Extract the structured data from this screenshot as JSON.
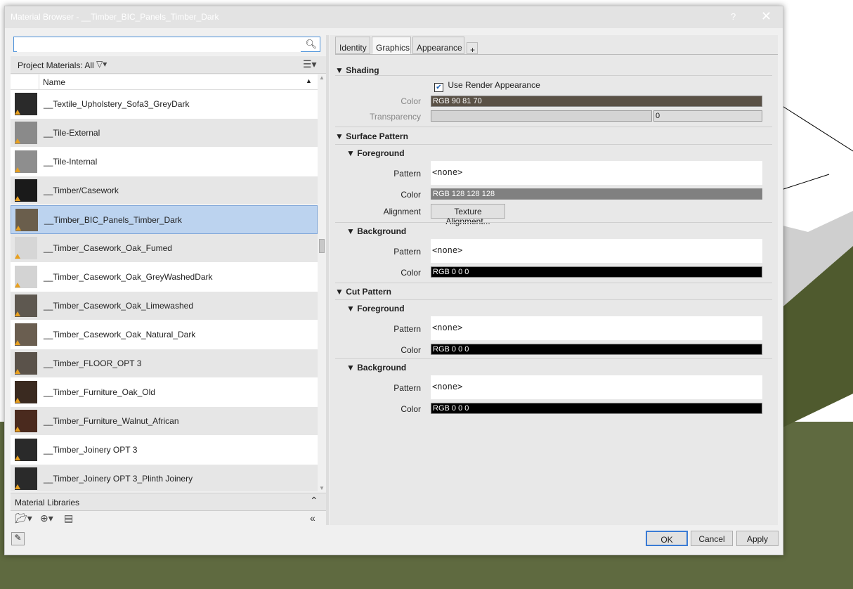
{
  "dialog": {
    "title": "Material Browser - __Timber_BIC_Panels_Timber_Dark",
    "help": "?",
    "close": "✕"
  },
  "search": {
    "value": "",
    "placeholder": ""
  },
  "project_bar": {
    "label": "Project Materials: All"
  },
  "list": {
    "header": {
      "name": "Name"
    },
    "items": [
      {
        "label": "__Textile_Upholstery_Sofa3_GreyDark",
        "thumb_color": "#2a2a2a"
      },
      {
        "label": "__Tile-External",
        "thumb_color": "#8a8a8a"
      },
      {
        "label": "__Tile-Internal",
        "thumb_color": "#8e8e8e"
      },
      {
        "label": "__Timber/Casework",
        "thumb_color": "#1a1a1a"
      },
      {
        "label": "__Timber_BIC_Panels_Timber_Dark",
        "thumb_color": "#6a5e4c"
      },
      {
        "label": "__Timber_Casework_Oak_Fumed",
        "thumb_color": "#d6d6d6"
      },
      {
        "label": "__Timber_Casework_Oak_GreyWashedDark",
        "thumb_color": "#d3d3d3"
      },
      {
        "label": "__Timber_Casework_Oak_Limewashed",
        "thumb_color": "#5e5850"
      },
      {
        "label": "__Timber_Casework_Oak_Natural_Dark",
        "thumb_color": "#6a5e50"
      },
      {
        "label": "__Timber_FLOOR_OPT 3",
        "thumb_color": "#5a524a"
      },
      {
        "label": "__Timber_Furniture_Oak_Old",
        "thumb_color": "#3a2a20"
      },
      {
        "label": "__Timber_Furniture_Walnut_African",
        "thumb_color": "#4a2a1e"
      },
      {
        "label": "__Timber_Joinery OPT 3",
        "thumb_color": "#2a2a2a"
      },
      {
        "label": "__Timber_Joinery OPT 3_Plinth Joinery",
        "thumb_color": "#2a2a2a"
      }
    ],
    "selected_index": 4
  },
  "libraries": {
    "label": "Material Libraries"
  },
  "tabs": [
    {
      "label": "Identity"
    },
    {
      "label": "Graphics"
    },
    {
      "label": "Appearance"
    },
    {
      "label": "+"
    }
  ],
  "graphics": {
    "shading": {
      "title": "Shading",
      "use_render_label": "Use Render Appearance",
      "use_render_checked": true,
      "color_label": "Color",
      "color_value": "RGB 90 81 70",
      "color_hex": "#5a5146",
      "transparency_label": "Transparency",
      "transparency_value": "0"
    },
    "surface": {
      "title": "Surface Pattern",
      "foreground": {
        "title": "Foreground",
        "pattern_label": "Pattern",
        "pattern_value": "<none>",
        "color_label": "Color",
        "color_value": "RGB 128 128 128",
        "color_hex": "#808080",
        "alignment_label": "Alignment",
        "alignment_button": "Texture Alignment..."
      },
      "background": {
        "title": "Background",
        "pattern_label": "Pattern",
        "pattern_value": "<none>",
        "color_label": "Color",
        "color_value": "RGB 0 0 0",
        "color_hex": "#000000"
      }
    },
    "cut": {
      "title": "Cut Pattern",
      "foreground": {
        "title": "Foreground",
        "pattern_label": "Pattern",
        "pattern_value": "<none>",
        "color_label": "Color",
        "color_value": "RGB 0 0 0",
        "color_hex": "#000000"
      },
      "background": {
        "title": "Background",
        "pattern_label": "Pattern",
        "pattern_value": "<none>",
        "color_label": "Color",
        "color_value": "RGB 0 0 0",
        "color_hex": "#000000"
      }
    }
  },
  "footer": {
    "ok": "OK",
    "cancel": "Cancel",
    "apply": "Apply"
  }
}
